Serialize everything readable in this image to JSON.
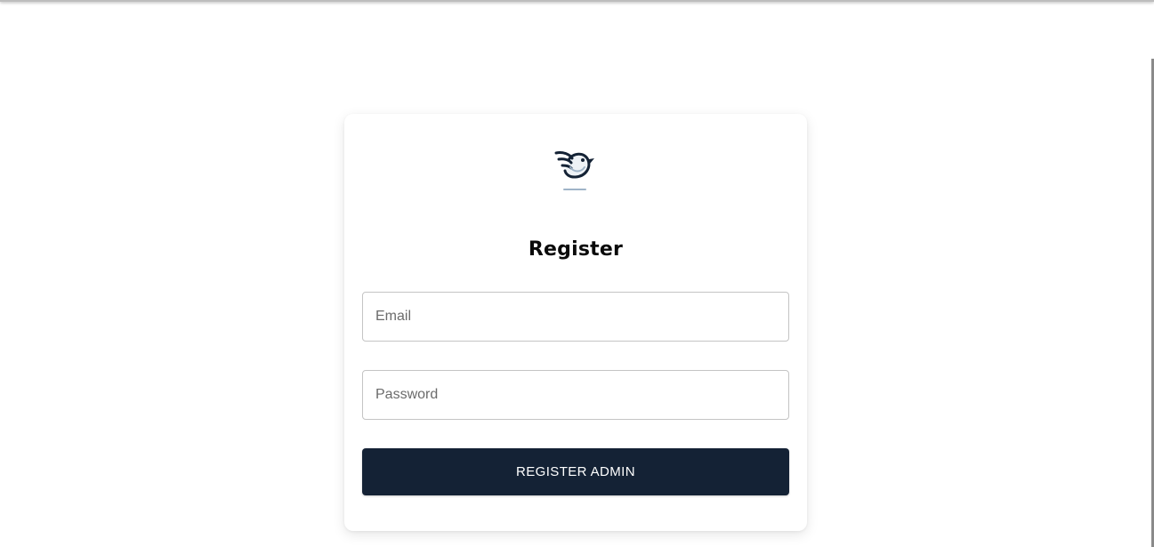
{
  "card": {
    "logo_icon": "bird-logo-icon",
    "title": "Register"
  },
  "form": {
    "email": {
      "value": "",
      "placeholder": "Email"
    },
    "password": {
      "value": "",
      "placeholder": "Password"
    },
    "submit_label": "REGISTER ADMIN"
  },
  "colors": {
    "button_bg": "#142235",
    "logo": "#142235",
    "logo_accent": "#9fb4c8"
  }
}
